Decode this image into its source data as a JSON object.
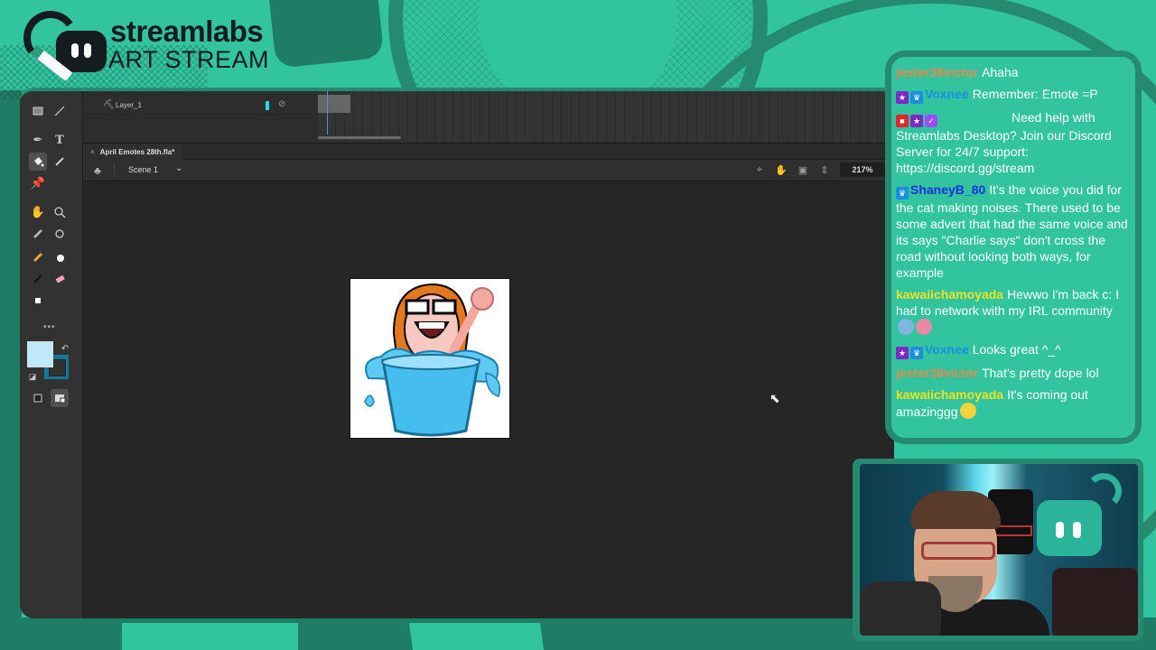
{
  "branding": {
    "title": "streamlabs",
    "subtitle": "ART STREAM",
    "accent": "#32c39f",
    "accent_dark": "#258a70"
  },
  "app": {
    "timeline": {
      "layer_name": "Layer_1",
      "layer_color": "#22d9f0"
    },
    "document_tab": {
      "close_label": "×",
      "title": "April Emotes 28th.fla*"
    },
    "scene": {
      "name": "Scene 1",
      "zoom": "217%"
    },
    "tools": [
      "rectangle-tool",
      "line-tool",
      "pen-tool",
      "text-tool",
      "paint-bucket-tool",
      "eyedropper-tool",
      "pin-tool",
      "hand-tool",
      "zoom-tool",
      "bone-tool",
      "bind-tool",
      "pencil-tool",
      "brush-tool",
      "ink-tool",
      "eraser-tool",
      "width-tool"
    ],
    "colors": {
      "fill": "#bfe9fb",
      "stroke": "#127799"
    },
    "canvas": {
      "content": "Emote: woman with glasses laughing in a bucket of water"
    }
  },
  "chat": {
    "messages": [
      {
        "user": "jester38victor",
        "user_color": "#e8894a",
        "badges": [],
        "text": "Ahaha"
      },
      {
        "user": "Voxnee",
        "user_color": "#1a8fe0",
        "badges": [
          "purple",
          "blue"
        ],
        "text": "Remember: Emote =P"
      },
      {
        "user": "",
        "user_color": "#ffffff",
        "badges": [
          "red",
          "purple",
          "verified"
        ],
        "text": "Need help with Streamlabs Desktop? Join our Discord Server for 24/7 support: https://discord.gg/stream"
      },
      {
        "user": "ShaneyB_80",
        "user_color": "#1c2fe0",
        "badges": [
          "blue"
        ],
        "text": "It's the voice you did for the cat making noises. There used to be some advert that had the same voice and its says \"Charlie says\" don't cross the road without looking both ways, for example"
      },
      {
        "user": "kawaiichamoyada",
        "user_color": "#f2e21b",
        "badges": [],
        "text": "Hewwo I'm back c: I had to network with my IRL community",
        "emotes": [
          "#7fb6e0",
          "#e98aa5"
        ]
      },
      {
        "user": "Voxnee",
        "user_color": "#1a8fe0",
        "badges": [
          "purple",
          "blue"
        ],
        "text": "Looks great ^_^"
      },
      {
        "user": "jester38victor",
        "user_color": "#e8894a",
        "badges": [],
        "text": "That's pretty dope lol"
      },
      {
        "user": "kawaiichamoyada",
        "user_color": "#f2e21b",
        "badges": [],
        "text": "It's coming out amazinggg",
        "emotes": [
          "#f4d33a"
        ]
      }
    ]
  },
  "webcam": {
    "label": "Streamer webcam"
  }
}
